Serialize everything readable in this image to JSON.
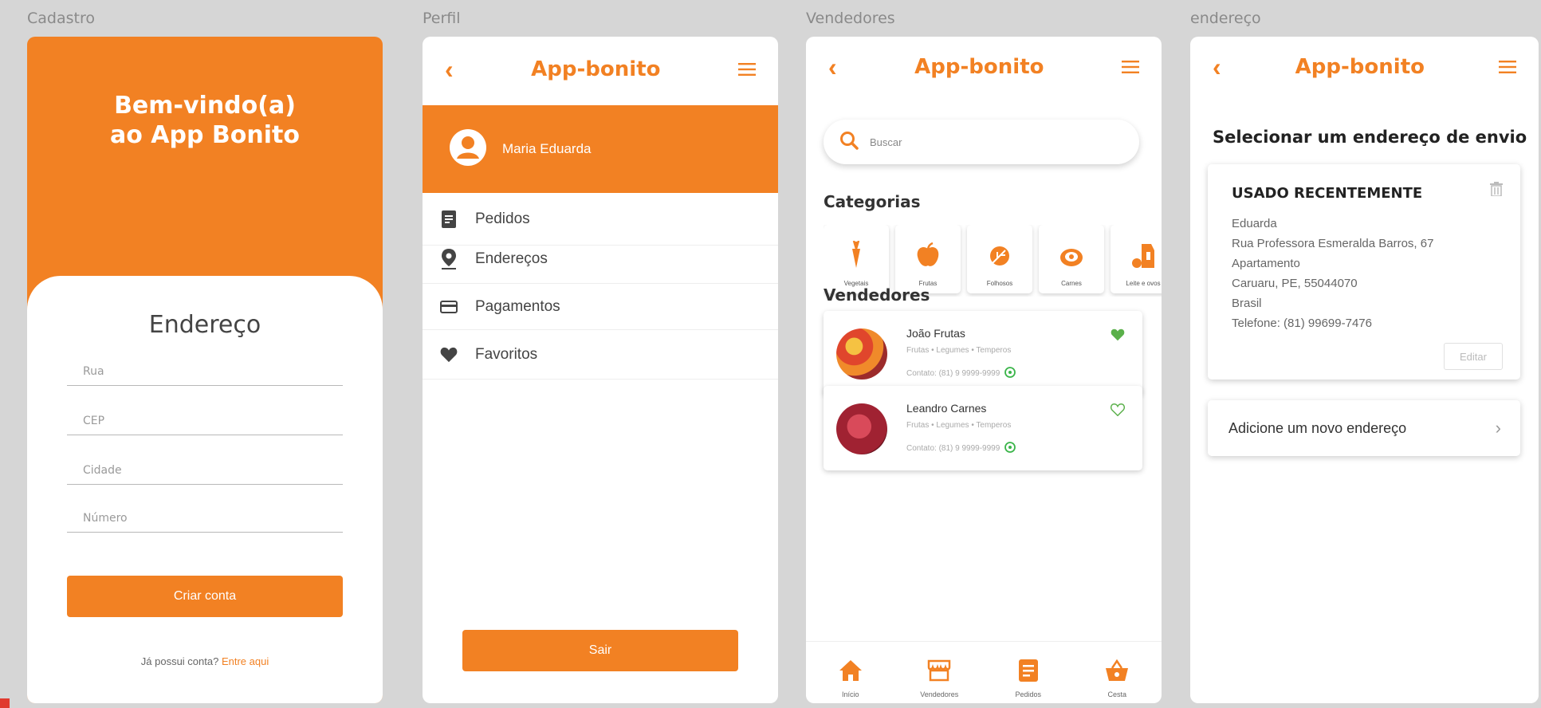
{
  "frames": {
    "cadastro": "Cadastro",
    "perfil": "Perfil",
    "vendedores": "Vendedores",
    "endereco": "endereço"
  },
  "cadastro": {
    "welcome_line1": "Bem-vindo(a)",
    "welcome_line2": "ao App Bonito",
    "form_title": "Endereço",
    "fields": [
      "Rua",
      "CEP",
      "Cidade",
      "Número"
    ],
    "submit": "Criar conta",
    "login_prompt": "Já possui conta?",
    "login_link": "Entre aqui"
  },
  "app": {
    "title": "App-bonito"
  },
  "perfil": {
    "user_name": "Maria Eduarda",
    "menu": [
      {
        "label": "Pedidos",
        "icon": "document-icon"
      },
      {
        "label": "Endereços",
        "icon": "location-pin-icon"
      },
      {
        "label": "Pagamentos",
        "icon": "credit-card-icon"
      },
      {
        "label": "Favoritos",
        "icon": "heart-icon"
      }
    ],
    "logout": "Sair"
  },
  "vendedores": {
    "search_placeholder": "Buscar",
    "categories_title": "Categorias",
    "categories": [
      {
        "label": "Vegetais",
        "icon": "carrot-icon"
      },
      {
        "label": "Frutas",
        "icon": "apple-icon"
      },
      {
        "label": "Folhosos",
        "icon": "leaf-icon"
      },
      {
        "label": "Carnes",
        "icon": "meat-icon"
      },
      {
        "label": "Leite e ovos",
        "icon": "milk-egg-icon"
      }
    ],
    "sellers_title": "Vendedores",
    "sellers": [
      {
        "name": "João Frutas",
        "tags": "Frutas • Legumes • Temperos",
        "contact": "Contato: (81) 9 9999-9999",
        "favorite": true
      },
      {
        "name": "Leandro Carnes",
        "tags": "Frutas • Legumes • Temperos",
        "contact": "Contato: (81) 9 9999-9999",
        "favorite": false
      }
    ],
    "tabs": [
      {
        "label": "Início",
        "icon": "home-icon"
      },
      {
        "label": "Vendedores",
        "icon": "store-icon"
      },
      {
        "label": "Pedidos",
        "icon": "document-icon"
      },
      {
        "label": "Cesta",
        "icon": "basket-icon"
      }
    ]
  },
  "endereco": {
    "heading": "Selecionar um endereço de envio",
    "recent_tag": "USADO RECENTEMENTE",
    "address_lines": [
      "Eduarda",
      "Rua Professora Esmeralda Barros, 67",
      "Apartamento",
      "Caruaru, PE, 55044070",
      "Brasil",
      "Telefone: (81) 99699-7476"
    ],
    "edit": "Editar",
    "add_new": "Adicione um novo endereço"
  },
  "colors": {
    "accent": "#f28123",
    "favorite_green": "#5ab04a",
    "background": "#d6d6d6"
  }
}
